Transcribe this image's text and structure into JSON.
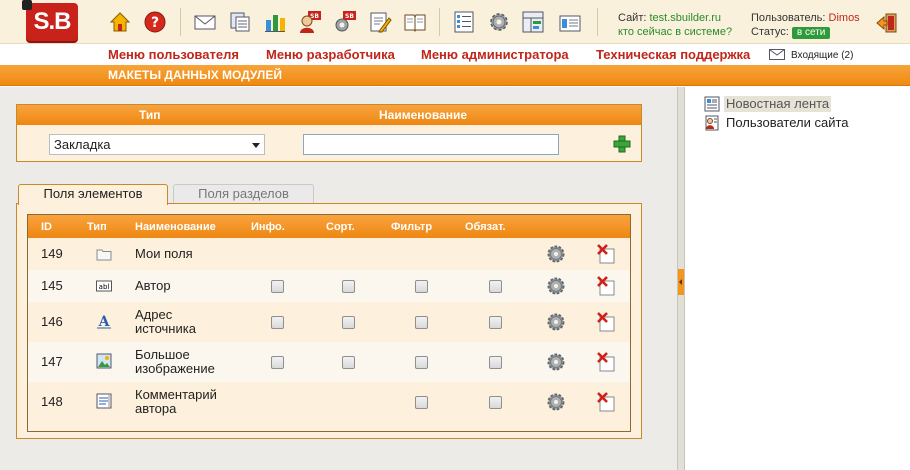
{
  "header": {
    "logo_text": "S.B",
    "site_label": "Сайт:",
    "site_url": "test.sbuilder.ru",
    "who_online": "кто сейчас в системе?",
    "user_label": "Пользователь:",
    "user_name": "Dimos",
    "status_label": "Статус:",
    "status_value": "в сети"
  },
  "menu": {
    "user_menu": "Меню пользователя",
    "dev_menu": "Меню разработчика",
    "admin_menu": "Меню администратора",
    "support": "Техническая поддержка",
    "inbox": "Входящие (2)"
  },
  "section_title": "МАКЕТЫ ДАННЫХ МОДУЛЕЙ",
  "filter": {
    "type_header": "Тип",
    "name_header": "Наименование",
    "type_value": "Закладка",
    "name_value": ""
  },
  "tabs": {
    "element_fields": "Поля элементов",
    "section_fields": "Поля разделов"
  },
  "table": {
    "headers": {
      "id": "ID",
      "type": "Тип",
      "name": "Наименование",
      "info": "Инфо.",
      "sort": "Сорт.",
      "filter": "Фильтр",
      "required": "Обязат."
    },
    "rows": [
      {
        "id": "149",
        "type_icon": "folder-icon",
        "name_line1": "Мои поля",
        "name_line2": "",
        "checkboxes": []
      },
      {
        "id": "145",
        "type_icon": "text-field-icon",
        "name_line1": "Автор",
        "name_line2": "",
        "checkboxes": [
          "info",
          "sort",
          "filter",
          "required"
        ]
      },
      {
        "id": "146",
        "type_icon": "font-icon",
        "name_line1": "Адрес",
        "name_line2": "источника",
        "checkboxes": [
          "info",
          "sort",
          "filter",
          "required"
        ]
      },
      {
        "id": "147",
        "type_icon": "image-icon",
        "name_line1": "Большое",
        "name_line2": "изображение",
        "checkboxes": [
          "info",
          "sort",
          "filter",
          "required"
        ]
      },
      {
        "id": "148",
        "type_icon": "text-area-icon",
        "name_line1": "Комментарий",
        "name_line2": "автора",
        "checkboxes": [
          "filter",
          "required"
        ]
      }
    ]
  },
  "sidebar": {
    "items": [
      {
        "label": "Новостная лента",
        "icon": "news-feed-icon",
        "selected": true
      },
      {
        "label": "Пользователи сайта",
        "icon": "site-users-icon",
        "selected": false
      }
    ]
  },
  "colors": {
    "accent_orange": "#ef8a12",
    "menu_red": "#c0261a",
    "status_green": "#2e9a3a",
    "panel_bg": "#fdf0dc"
  }
}
